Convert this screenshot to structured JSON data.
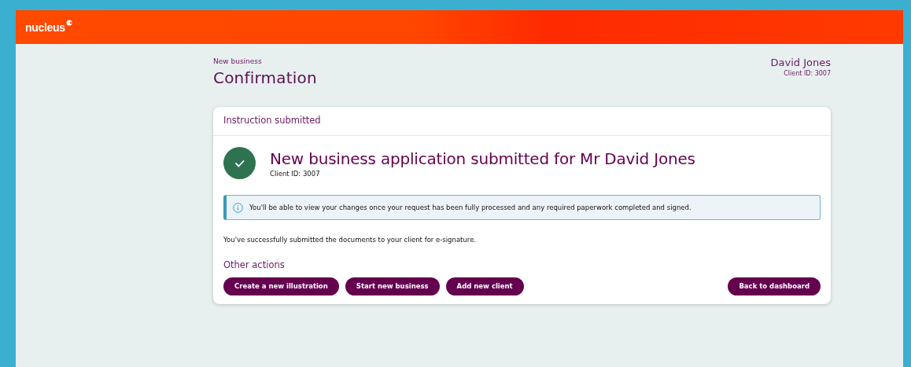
{
  "header": {
    "logo": "nucleus"
  },
  "page": {
    "breadcrumb": "New business",
    "title": "Confirmation",
    "client_name": "David Jones",
    "client_id": "Client ID: 3007"
  },
  "card": {
    "heading": "Instruction submitted",
    "success": {
      "title": "New business application submitted for Mr David Jones",
      "client_id": "Client ID: 3007"
    },
    "notice": "You'll be able to view your changes once your request has been fully processed and any required paperwork completed and signed.",
    "message": "You've successfully submitted the documents to your client for e-signature.",
    "actions_heading": "Other actions",
    "actions": [
      {
        "label": "Create a new illustration"
      },
      {
        "label": "Start new business"
      },
      {
        "label": "Add new client"
      }
    ],
    "back_button": "Back to dashboard"
  }
}
